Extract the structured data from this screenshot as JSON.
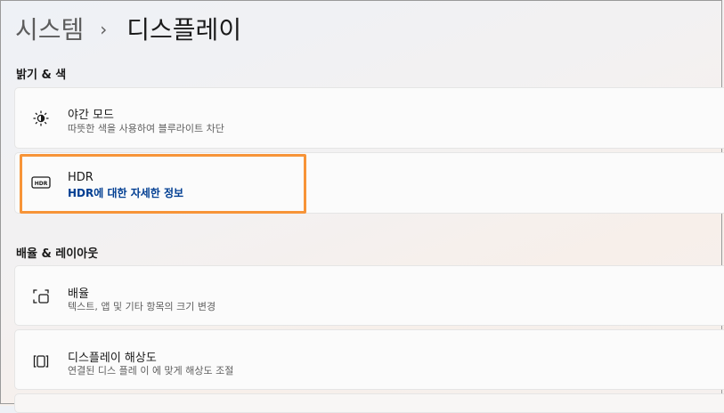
{
  "breadcrumb": {
    "parent": "시스템",
    "separator": "›",
    "current": "디스플레이"
  },
  "sections": {
    "brightness_color": "밝기 & 색",
    "scale_layout": "배율 & 레이아웃"
  },
  "items": {
    "night_light": {
      "title": "야간 모드",
      "subtitle": "따뜻한 색을 사용하여 블루라이트 차단",
      "icon": "brightness-icon"
    },
    "hdr": {
      "title": "HDR",
      "link": "HDR에 대한 자세한 정보",
      "icon": "hdr-icon"
    },
    "scale": {
      "title": "배율",
      "subtitle": "텍스트, 앱 및 기타 항목의 크기 변경",
      "icon": "scale-icon"
    },
    "resolution": {
      "title": "디스플레이 해상도",
      "subtitle": "연결된 디스 플레 이 에 맞게 해상도 조절",
      "icon": "resolution-icon"
    }
  },
  "colors": {
    "accent_link": "#003e92",
    "highlight": "#f79438"
  }
}
